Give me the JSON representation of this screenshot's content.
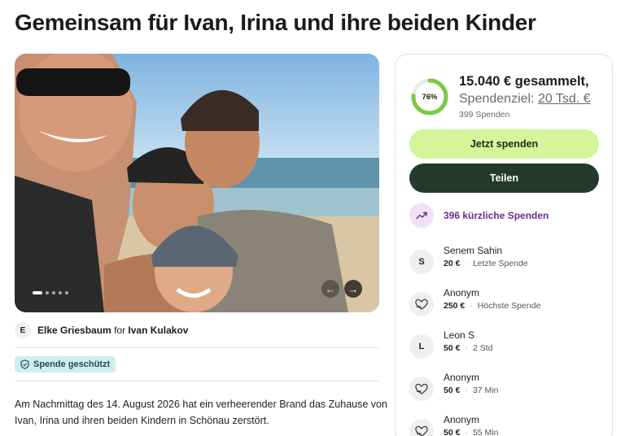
{
  "page_title": "Gemeinsam für Ivan, Irina und ihre beiden Kinder",
  "organizer": {
    "avatar_letter": "E",
    "name": "Elke Griesbaum",
    "for_word": "for",
    "beneficiary": "Ivan Kulakov"
  },
  "badge": "Spende geschützt",
  "story": "Am Nachmittag des 14. August 2026 hat ein verheerender Brand das Zuhause von Ivan, Irina und ihren beiden Kindern in Schönau zerstört.",
  "carousel": {
    "slide_count": 5,
    "active_index": 0
  },
  "fundraiser": {
    "progress_percent": 76,
    "progress_label": "76%",
    "raised_text": "15.040 € gesammelt,",
    "goal_prefix": "Spendenziel:",
    "goal_value": "20 Tsd. €",
    "donations_count": "399 Spenden",
    "donate_button": "Jetzt spenden",
    "share_button": "Teilen",
    "recent_label": "396 kürzliche Spenden"
  },
  "donations": [
    {
      "avatar": "S",
      "avatar_type": "letter",
      "name": "Senem Sahin",
      "amount": "20 €",
      "note": "Letzte Spende"
    },
    {
      "avatar": "heart-hand-icon",
      "avatar_type": "icon",
      "name": "Anonym",
      "amount": "250 €",
      "note": "Höchste Spende"
    },
    {
      "avatar": "L",
      "avatar_type": "letter",
      "name": "Leon S",
      "amount": "50 €",
      "note": "2 Std"
    },
    {
      "avatar": "heart-hand-icon",
      "avatar_type": "icon",
      "name": "Anonym",
      "amount": "50 €",
      "note": "37 Min"
    },
    {
      "avatar": "heart-hand-icon",
      "avatar_type": "icon",
      "name": "Anonym",
      "amount": "50 €",
      "note": "55 Min"
    }
  ],
  "colors": {
    "donate_button": "#d4f59a",
    "share_button": "#243a2c",
    "progress": "#7ac943",
    "recent_accent": "#6a2a94",
    "badge": "#cfeeee"
  }
}
